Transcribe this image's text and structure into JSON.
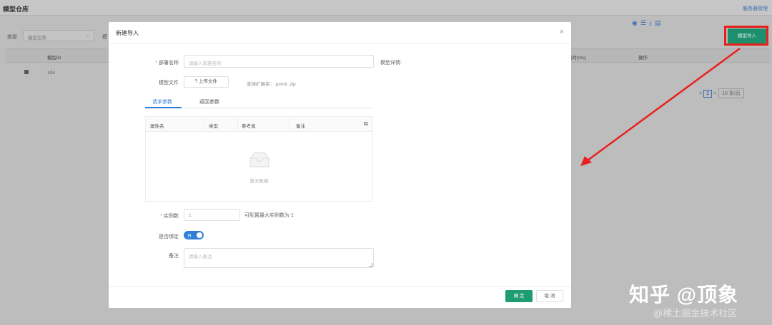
{
  "background": {
    "page_title": "模型仓库",
    "top_link": "服务器管理",
    "filter_label_type": "类型",
    "filter_select_value": "模型名称",
    "filter_label_2": "模",
    "table_headers": {
      "model_id": "模型ID",
      "time": "耗时(ms)",
      "ops": "操作"
    },
    "table_row": {
      "id": "104"
    },
    "ops_icons": [
      "eye-icon",
      "settings-icon",
      "download-icon",
      "document-icon"
    ],
    "pager": {
      "prev": "<",
      "current": "1",
      "next": ">",
      "page_size": "10 条/页"
    },
    "import_button": "模型导入",
    "highlight_color": "#e8201c"
  },
  "modal": {
    "title": "新建导入",
    "close_icon": "×",
    "fields": {
      "deploy_name": {
        "label": "部署名称",
        "placeholder": "请输入部署名称"
      },
      "model_detail": {
        "label": "模型详情"
      },
      "model_file": {
        "label": "模型文件",
        "upload_button": "上传文件",
        "hint": "支持扩展名：.pmml .zip"
      },
      "instances": {
        "label": "实例数",
        "value": "1",
        "hint": "可配置最大实例数为 1"
      },
      "is_bind": {
        "label": "是否绑定",
        "switch_text": "开"
      },
      "remark": {
        "label": "备注",
        "placeholder": "请输入备注"
      }
    },
    "tabs": [
      "请求参数",
      "返回参数"
    ],
    "param_table": {
      "headers": [
        "属性名",
        "类型",
        "参考值",
        "备注"
      ],
      "empty_text": "暂无数据"
    },
    "buttons": {
      "ok": "确 定",
      "cancel": "取 消"
    }
  },
  "watermark": {
    "line1": "知乎 @顶象",
    "line2": "@稀土掘金技术社区"
  },
  "colors": {
    "primary": "#2f7ed8",
    "ok_button": "#1e9c72",
    "arrow": "#e8201c"
  }
}
